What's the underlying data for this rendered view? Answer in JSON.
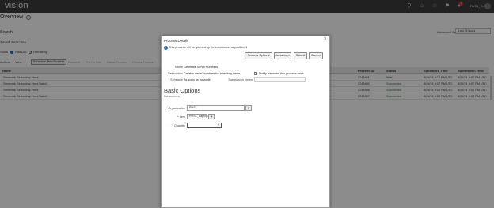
{
  "app": {
    "logo": "vision",
    "user": "RVS1_Empl1",
    "notif_count": "1"
  },
  "page": {
    "title": "Overview",
    "search_header": "Search",
    "advanced_search": "Advanced Search",
    "range_value": "Last 24 hours",
    "saved_searches": "Saved Searches"
  },
  "filters": {
    "prefix": "Show",
    "list_label": "Flat List",
    "hierarchy_label": "Hierarchy"
  },
  "toolbar": {
    "actions": "Actions",
    "view": "View",
    "schedule": "Schedule New Process",
    "resubmit": "Resubmit",
    "put_on_hold": "Put On Hold",
    "cancel_process": "Cancel Process",
    "release_process": "Release Process"
  },
  "grid": {
    "headers": {
      "name": "Name",
      "process_id": "Process ID",
      "status": "Status",
      "scheduled": "Scheduled Time",
      "submission": "Submission Time"
    },
    "rows": [
      {
        "name": "Generate Relevancy Feed",
        "id": "2243401",
        "status": "Wait",
        "scheduled": "8/29/21 8:12 PM UTC",
        "submission": "8/29/21 8:07 PM UTC"
      },
      {
        "name": "Generate Relevancy Feed Batch",
        "id": "2243400",
        "status": "Succeeded",
        "scheduled": "8/29/21 8:07 PM UTC",
        "submission": "8/29/21 8:07 PM UTC"
      },
      {
        "name": "Generate Relevancy Feed",
        "id": "2243398",
        "status": "Succeeded",
        "scheduled": "8/29/21 8:02 PM UTC",
        "submission": "8/29/21 8:02 PM UTC"
      },
      {
        "name": "Generate Relevancy Feed Batch",
        "id": "2243397",
        "status": "Succeeded",
        "scheduled": "8/29/21 8:02 PM UTC",
        "submission": "8/29/21 8:02 PM UTC"
      }
    ]
  },
  "dialog": {
    "title": "Process Details",
    "info": "This process will be queued up for submission at position 1",
    "buttons": {
      "process_options": "Process Options",
      "advanced": "Advanced",
      "submit": "Submit",
      "cancel": "Cancel"
    },
    "name_label": "Name",
    "name_value": "Generate Serial Numbers",
    "desc_label": "Description",
    "desc_value": "Creates serial numbers for inventory items",
    "notify_label": "Notify me when this process ends",
    "schedule_label": "Schedule",
    "schedule_value": "As soon as possible",
    "notes_label": "Submission Notes",
    "section_title": "Basic Options",
    "section_sub": "Parameters",
    "org_label": "Organization",
    "org_value": "RVS1",
    "item_label": "Item",
    "item_value": "RVS1_Laptop1",
    "qty_label": "Quantity",
    "qty_value": "2"
  },
  "colors": {
    "topbar": "#3d3d3d",
    "accent": "#2b6ab3",
    "success": "#2c7a3d"
  }
}
